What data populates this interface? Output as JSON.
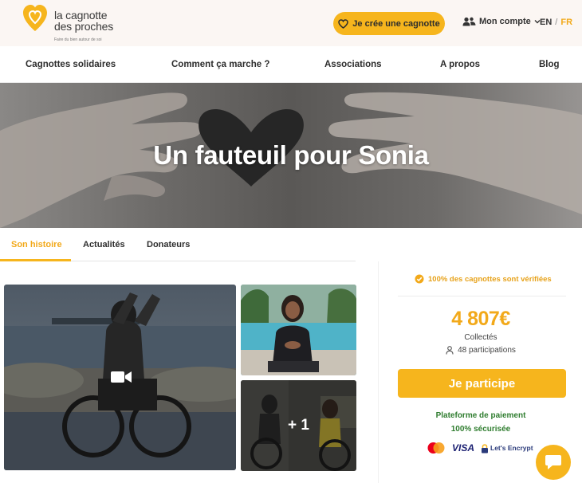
{
  "header": {
    "logo_line1": "la cagnotte",
    "logo_line2": "des proches",
    "logo_tagline": "Faire du bien autour de soi",
    "create_button": "Je crée une cagnotte",
    "account_label": "Mon compte",
    "lang_en": "EN",
    "lang_sep": "/",
    "lang_fr": "FR"
  },
  "nav": {
    "items": [
      "Cagnottes solidaires",
      "Comment ça marche ?",
      "Associations",
      "A propos",
      "Blog"
    ]
  },
  "hero": {
    "title": "Un fauteuil pour Sonia"
  },
  "tabs": {
    "items": [
      "Son histoire",
      "Actualités",
      "Donateurs"
    ],
    "active": "Son histoire"
  },
  "gallery": {
    "more_count": "+ 1"
  },
  "card": {
    "verified_text": "100% des cagnottes sont vérifiées",
    "amount": "4 807€",
    "collected_label": "Collectés",
    "participations": "48 participations",
    "participate_button": "Je participe",
    "secure_line1": "Plateforme de paiement",
    "secure_line2": "100% sécurisée",
    "visa": "VISA",
    "letsencrypt": "Let's Encrypt"
  },
  "colors": {
    "accent": "#f6b51d",
    "accent_text": "#f2a91a",
    "secure_green": "#2f7d2f"
  },
  "icons": [
    "heart-logo-icon",
    "heart-outline-icon",
    "users-icon",
    "chevron-down-icon",
    "video-camera-icon",
    "check-badge-icon",
    "user-icon",
    "mastercard-icon",
    "lock-icon",
    "chat-icon"
  ]
}
